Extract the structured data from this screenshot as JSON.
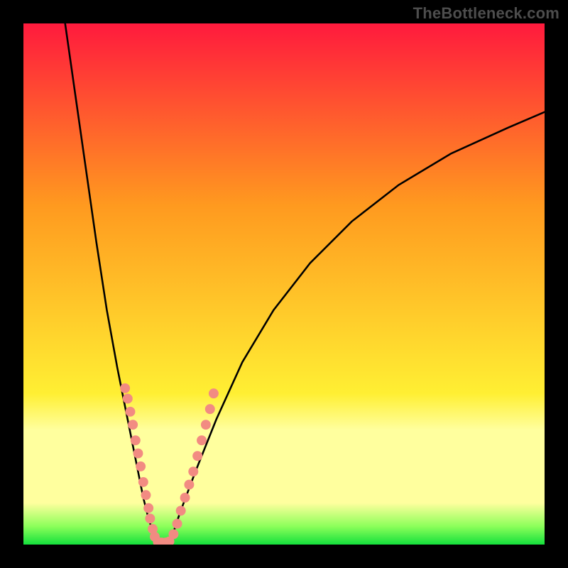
{
  "watermark": "TheBottleneck.com",
  "colors": {
    "red": "#ff1a3d",
    "orange": "#ff9a1f",
    "yellow": "#ffef33",
    "pale_yellow": "#ffff9e",
    "green_light": "#8cff5a",
    "green": "#14e03c",
    "black": "#000000",
    "curve": "#000000",
    "dots": "#f28b82"
  },
  "chart_data": {
    "type": "line",
    "title": "",
    "xlabel": "",
    "ylabel": "",
    "xlim": [
      0,
      100
    ],
    "ylim": [
      0,
      100
    ],
    "legend": false,
    "grid": false,
    "curves": [
      {
        "name": "left-branch",
        "x": [
          8,
          10,
          12,
          14,
          16,
          18,
          20,
          22,
          23,
          24,
          25,
          25.5
        ],
        "y": [
          100,
          86,
          72,
          58,
          45,
          34,
          24,
          14,
          9,
          5,
          2,
          0
        ]
      },
      {
        "name": "right-branch",
        "x": [
          28,
          30,
          33,
          37,
          42,
          48,
          55,
          63,
          72,
          82,
          93,
          100
        ],
        "y": [
          0,
          6,
          14,
          24,
          35,
          45,
          54,
          62,
          69,
          75,
          80,
          83
        ]
      }
    ],
    "floor_line": {
      "x": [
        25.5,
        28
      ],
      "y": [
        0,
        0
      ]
    },
    "scatter": {
      "name": "marker-dots",
      "points": [
        [
          19.5,
          30
        ],
        [
          20,
          28
        ],
        [
          20.5,
          25.5
        ],
        [
          21,
          23
        ],
        [
          21.5,
          20
        ],
        [
          22,
          17.5
        ],
        [
          22.5,
          15
        ],
        [
          23,
          12
        ],
        [
          23.5,
          9.5
        ],
        [
          24,
          7
        ],
        [
          24.3,
          5
        ],
        [
          24.8,
          3
        ],
        [
          25.2,
          1.5
        ],
        [
          25.8,
          0.5
        ],
        [
          26.5,
          0.4
        ],
        [
          27.3,
          0.4
        ],
        [
          28,
          0.6
        ],
        [
          28.8,
          2
        ],
        [
          29.5,
          4
        ],
        [
          30.2,
          6.5
        ],
        [
          31,
          9
        ],
        [
          31.8,
          11.5
        ],
        [
          32.6,
          14
        ],
        [
          33.4,
          17
        ],
        [
          34.2,
          20
        ],
        [
          35,
          23
        ],
        [
          35.8,
          26
        ],
        [
          36.5,
          29
        ]
      ]
    },
    "gradient_bands": [
      {
        "y0": 0,
        "y1": 71,
        "from": "red",
        "to": "yellow"
      },
      {
        "y0": 71,
        "y1": 78,
        "from": "yellow",
        "to": "pale_yellow"
      },
      {
        "y0": 78,
        "y1": 92,
        "from": "pale_yellow",
        "to": "pale_yellow"
      },
      {
        "y0": 92,
        "y1": 97,
        "from": "pale_yellow",
        "to": "green_light"
      },
      {
        "y0": 97,
        "y1": 100,
        "from": "green_light",
        "to": "green"
      }
    ]
  }
}
